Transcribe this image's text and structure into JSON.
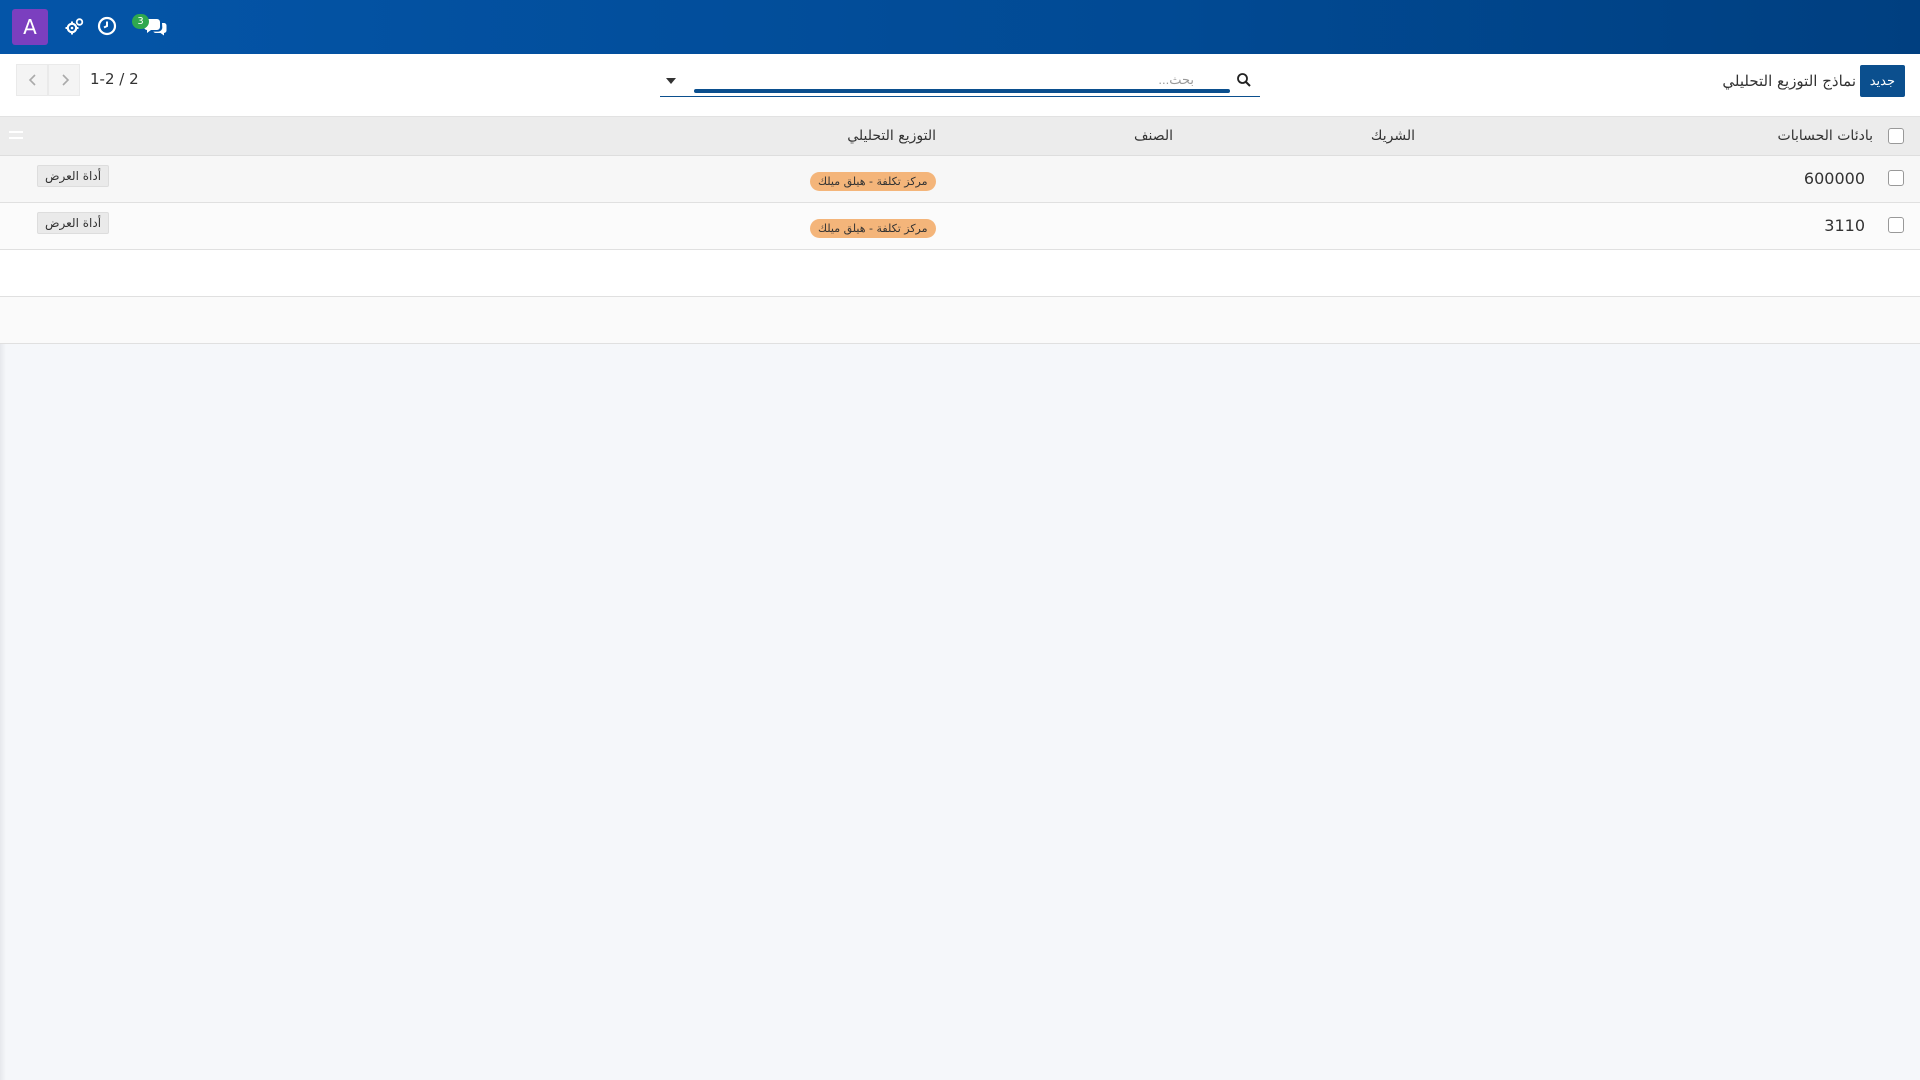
{
  "topbar": {
    "avatar_letter": "A",
    "icons": [
      "settings-gears-icon",
      "clock-icon",
      "chat-icon"
    ],
    "chat_badge": "3",
    "colors": {
      "bar": "#0455a8",
      "avatar": "#7b3fbf",
      "badge": "#2fa84f"
    }
  },
  "control": {
    "new_button": "جديد",
    "title": "نماذج التوزيع التحليلي",
    "search_placeholder": "بحث...",
    "pager": "1-2 / 2"
  },
  "table": {
    "headers": {
      "account_prefix": "بادئات الحسابات",
      "partner": "الشريك",
      "category": "الصنف",
      "distribution": "التوزيع التحليلي"
    },
    "rows": [
      {
        "account": "600000",
        "partner": "",
        "category": "",
        "distribution": "مركز تكلفة - هيلق ميلك",
        "widget": "أداة العرض"
      },
      {
        "account": "3110",
        "partner": "",
        "category": "",
        "distribution": "مركز تكلفة - هيلق ميلك",
        "widget": "أداة العرض"
      }
    ],
    "tag_color": "#f4b57a"
  }
}
